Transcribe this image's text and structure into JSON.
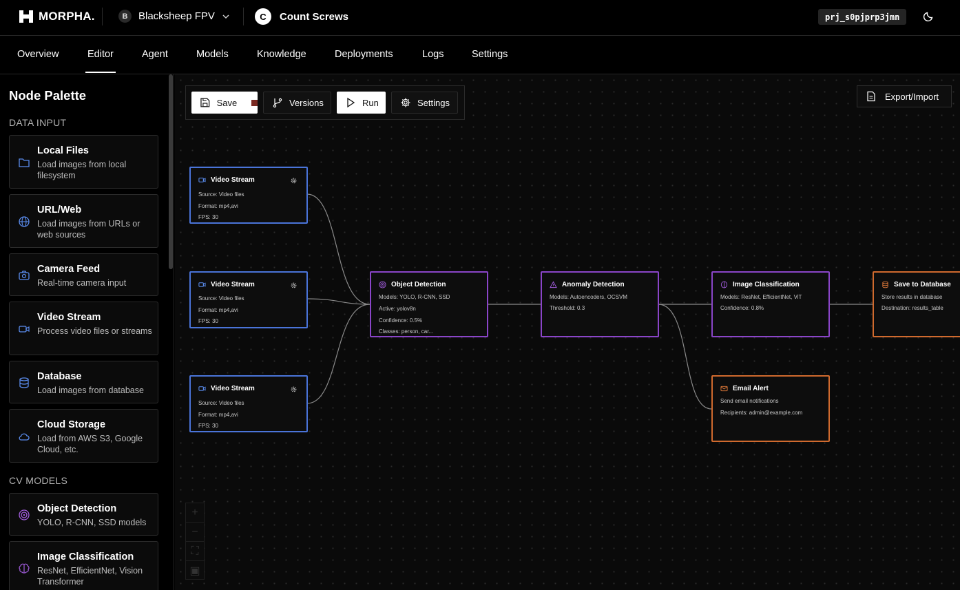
{
  "brand": {
    "name": "MORPHA."
  },
  "org": {
    "initial": "B",
    "name": "Blacksheep FPV"
  },
  "project": {
    "initial": "C",
    "name": "Count Screws",
    "id": "prj_s0pjprp3jmn"
  },
  "nav": {
    "tabs": [
      "Overview",
      "Editor",
      "Agent",
      "Models",
      "Knowledge",
      "Deployments",
      "Logs",
      "Settings"
    ],
    "active": "Editor"
  },
  "sidebar": {
    "title": "Node Palette",
    "sections": [
      {
        "label": "DATA INPUT"
      },
      {
        "label": "CV MODELS"
      }
    ],
    "items": [
      {
        "title": "Local Files",
        "desc": "Load images from local filesystem",
        "icon": "folder-icon"
      },
      {
        "title": "URL/Web",
        "desc": "Load images from URLs or web sources",
        "icon": "globe-icon"
      },
      {
        "title": "Camera Feed",
        "desc": "Real-time camera input",
        "icon": "camera-icon"
      },
      {
        "title": "Video Stream",
        "desc": "Process video files or streams",
        "icon": "video-icon"
      },
      {
        "title": "Database",
        "desc": "Load images from database",
        "icon": "database-icon"
      },
      {
        "title": "Cloud Storage",
        "desc": "Load from AWS S3, Google Cloud, etc.",
        "icon": "cloud-icon"
      },
      {
        "title": "Object Detection",
        "desc": "YOLO, R-CNN, SSD models",
        "icon": "target-icon"
      },
      {
        "title": "Image Classification",
        "desc": "ResNet, EfficientNet, Vision Transformer",
        "icon": "brain-icon"
      }
    ]
  },
  "toolbar": {
    "save": "Save",
    "versions": "Versions",
    "run": "Run",
    "settings": "Settings",
    "export": "Export/Import"
  },
  "nodes": [
    {
      "title": "Video Stream",
      "lines": [
        "Source: Video files",
        "Format: mp4,avi",
        "FPS: 30"
      ]
    },
    {
      "title": "Video Stream",
      "lines": [
        "Source: Video files",
        "Format: mp4,avi",
        "FPS: 30"
      ]
    },
    {
      "title": "Video Stream",
      "lines": [
        "Source: Video files",
        "Format: mp4,avi",
        "FPS: 30"
      ]
    },
    {
      "title": "Object Detection",
      "lines": [
        "Models: YOLO, R-CNN, SSD",
        "Active: yolov8n",
        "Confidence: 0.5%",
        "Classes: person, car..."
      ]
    },
    {
      "title": "Anomaly Detection",
      "lines": [
        "Models: Autoencoders, OCSVM",
        "Threshold: 0.3"
      ]
    },
    {
      "title": "Image Classification",
      "lines": [
        "Models: ResNet, EfficientNet, ViT",
        "Confidence: 0.8%"
      ]
    },
    {
      "title": "Save to Database",
      "lines": [
        "Store results in database",
        "Destination: results_table"
      ]
    },
    {
      "title": "Email Alert",
      "lines": [
        "Send email notifications",
        "Recipients: admin@example.com"
      ]
    }
  ],
  "colors": {
    "input": "#4a74d9",
    "model": "#8a45c8",
    "output": "#d06a2e",
    "unsaved": "#7a2a22"
  }
}
